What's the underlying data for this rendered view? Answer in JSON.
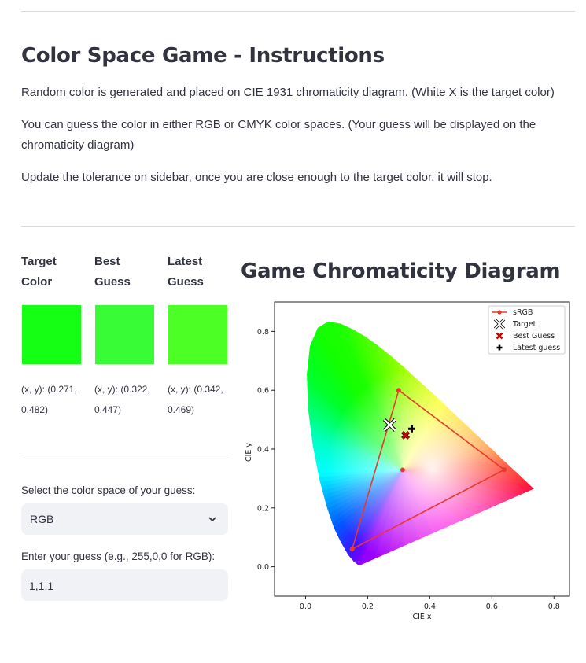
{
  "header": {
    "title": "Color Space Game - Instructions"
  },
  "instructions": {
    "line1": "Random color is generated and placed on CIE 1931 chromaticity diagram. (White X is the target color)",
    "line2": "You can guess the color in either RGB or CMYK color spaces. (Your guess will be displayed on the chromaticity diagram)",
    "line3": "Update the tolerance on sidebar, once you are close enough to the target color, it will stop."
  },
  "swatches": [
    {
      "heading": "Target Color",
      "color": "#14ff14",
      "coord": "(x, y): (0.271, 0.482)"
    },
    {
      "heading": "Best Guess",
      "color": "#38fc36",
      "coord": "(x, y): (0.322, 0.447)"
    },
    {
      "heading": "Latest Guess",
      "color": "#4cff24",
      "coord": "(x, y): (0.342, 0.469)"
    }
  ],
  "form": {
    "color_space_label": "Select the color space of your guess:",
    "color_space_value": "RGB",
    "guess_label": "Enter your guess (e.g., 255,0,0 for RGB):",
    "guess_value": "1,1,1"
  },
  "chart_title": "Game Chromaticity Diagram",
  "chart_data": {
    "type": "scatter",
    "xlabel": "CIE x",
    "ylabel": "CIE y",
    "xlim": [
      -0.1,
      0.85
    ],
    "ylim": [
      -0.1,
      0.9
    ],
    "xticks": [
      "0.0",
      "0.2",
      "0.4",
      "0.6",
      "0.8"
    ],
    "yticks": [
      "0.0",
      "0.2",
      "0.4",
      "0.6",
      "0.8"
    ],
    "legend_position": "top-right",
    "srgb_triangle": {
      "name": "sRGB",
      "color": "#e8392c",
      "points": [
        [
          0.64,
          0.33
        ],
        [
          0.3,
          0.6
        ],
        [
          0.15,
          0.06
        ],
        [
          0.64,
          0.33
        ]
      ]
    },
    "white_point": [
      0.3127,
      0.329
    ],
    "target": {
      "name": "Target",
      "x": 0.271,
      "y": 0.482
    },
    "best_guess": {
      "name": "Best Guess",
      "x": 0.322,
      "y": 0.447,
      "color": "#cc0000"
    },
    "latest_guess": {
      "name": "Latest guess",
      "x": 0.342,
      "y": 0.469,
      "color": "#000000"
    }
  }
}
